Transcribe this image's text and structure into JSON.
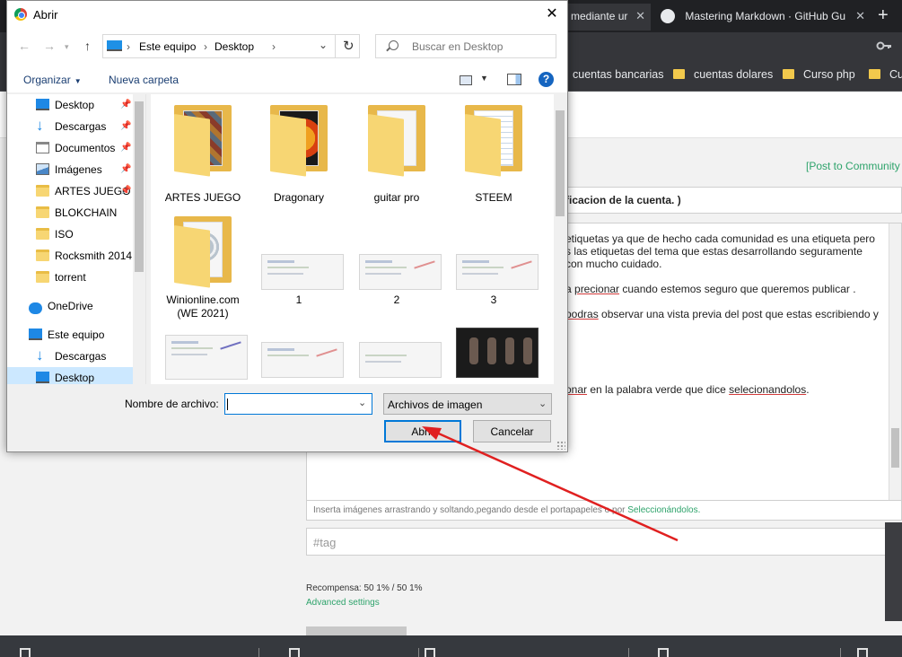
{
  "browser": {
    "tabs": [
      {
        "label": "mediante ur"
      },
      {
        "label": "Mastering Markdown · GitHub Gu"
      }
    ],
    "bookmarks": [
      "cuentas bancarias",
      "cuentas dolares",
      "Curso php",
      "Cu"
    ]
  },
  "page": {
    "post_link": "[Post to Community",
    "title_value": "ficacion de la cuenta. )",
    "editor_lines": [
      {
        "pre": "etiquetas ya que de hecho cada comunidad es una etiqueta pero",
        "u": "",
        "post": ""
      },
      {
        "pre": "s las etiquetas del tema que estas desarrollando seguramente",
        "u": "",
        "post": ""
      },
      {
        "pre": "con mucho cuidado.",
        "u": "",
        "post": ""
      },
      {
        "pre": "a ",
        "u": "precionar",
        "post": " cuando estemos seguro que queremos publicar ."
      },
      {
        "pre": "",
        "u": "podras",
        "post": " observar una vista previa del post que estas escribiendo y"
      },
      {
        "pre": "",
        "u": "onar",
        "post": " en la palabra verde que dice "
      },
      {
        "pre": "",
        "u": "",
        "post": ""
      }
    ],
    "editor_last_link": "selecionandolos",
    "editor_last_tail": ".",
    "image_hint": "Inserta imágenes arrastrando y soltando,pegando desde el portapapeles o por ",
    "image_hint_link": "Seleccionándolos.",
    "tag_placeholder": "#tag",
    "reward": "Recompensa: 50 1% / 50 1%",
    "advanced": "Advanced settings"
  },
  "dialog": {
    "title": "Abrir",
    "breadcrumb": [
      "Este equipo",
      "Desktop"
    ],
    "search_placeholder": "Buscar en Desktop",
    "organize": "Organizar",
    "new_folder": "Nueva carpeta",
    "nav_items": [
      {
        "label": "Desktop",
        "icon": "desktop-icon",
        "pinned": true
      },
      {
        "label": "Descargas",
        "icon": "download-icon",
        "pinned": true
      },
      {
        "label": "Documentos",
        "icon": "documents-icon",
        "pinned": true
      },
      {
        "label": "Imágenes",
        "icon": "pictures-icon",
        "pinned": true
      },
      {
        "label": "ARTES JUEGO",
        "icon": "folder-icon",
        "pinned": true
      },
      {
        "label": "BLOKCHAIN",
        "icon": "folder-icon",
        "pinned": false
      },
      {
        "label": "ISO",
        "icon": "folder-icon",
        "pinned": false
      },
      {
        "label": "Rocksmith 2014",
        "icon": "folder-icon",
        "pinned": false
      },
      {
        "label": "torrent",
        "icon": "folder-icon",
        "pinned": false
      },
      {
        "label": "OneDrive",
        "icon": "onedrive-icon",
        "pinned": false
      },
      {
        "label": "Este equipo",
        "icon": "this-pc-icon",
        "pinned": false
      },
      {
        "label": "Descargas",
        "icon": "download-icon",
        "pinned": false
      },
      {
        "label": "Desktop",
        "icon": "desktop-icon",
        "pinned": false,
        "selected": true
      }
    ],
    "files": [
      {
        "label": "ARTES JUEGO",
        "kind": "folder"
      },
      {
        "label": "Dragonary",
        "kind": "folder"
      },
      {
        "label": "guitar pro",
        "kind": "folder"
      },
      {
        "label": "STEEM",
        "kind": "folder"
      },
      {
        "label": "Winionline.com (WE 2021)",
        "kind": "folder"
      },
      {
        "label": "1",
        "kind": "image"
      },
      {
        "label": "2",
        "kind": "image"
      },
      {
        "label": "3",
        "kind": "image"
      }
    ],
    "filename_label": "Nombre de archivo:",
    "filename_value": "",
    "filetype": "Archivos de imagen",
    "open_button": "Abrir",
    "cancel_button": "Cancelar",
    "colors": {
      "accent": "#0078d7",
      "annotation_arrow": "#e02020",
      "folder": "#f7d673"
    }
  }
}
